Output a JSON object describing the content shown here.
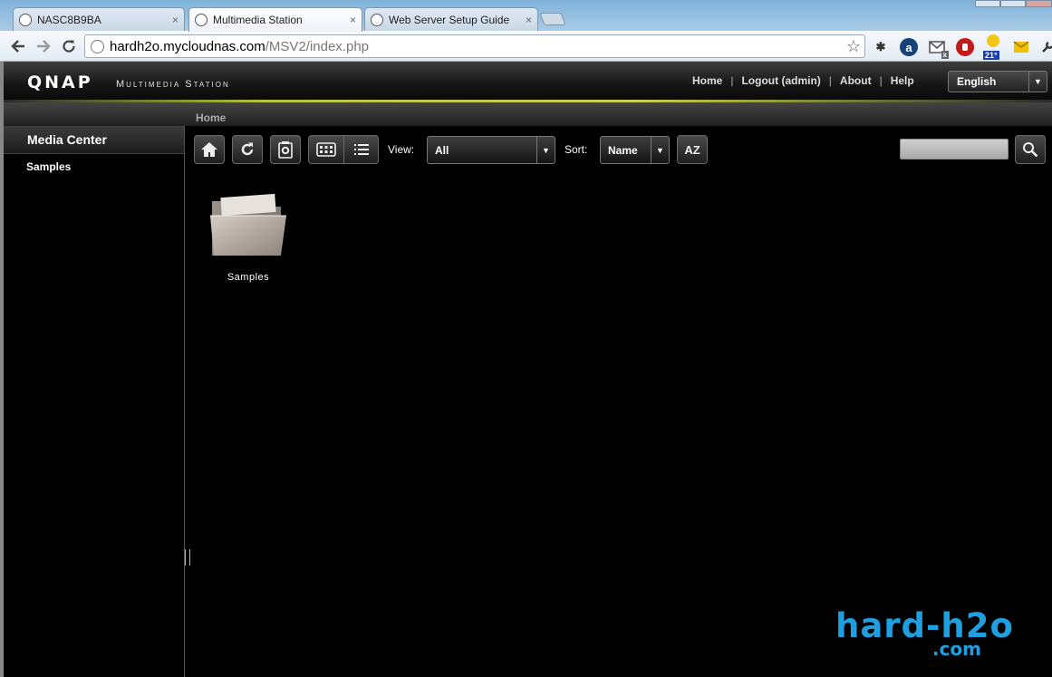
{
  "browser": {
    "tabs": [
      {
        "title": "NASC8B9BA",
        "active": false
      },
      {
        "title": "Multimedia Station",
        "active": true
      },
      {
        "title": "Web Server Setup Guide",
        "active": false
      }
    ],
    "close_glyph": "×",
    "address": {
      "host": "hardh2o.mycloudnas.com",
      "path": "/MSV2/index.php"
    },
    "extensions": {
      "mail_badge": "x",
      "weather_temp": "21°",
      "amazon_letter": "a"
    }
  },
  "app": {
    "logo_text": "QNAP",
    "title": "Multimedia Station",
    "nav": {
      "home": "Home",
      "logout": "Logout (admin)",
      "about": "About",
      "help": "Help",
      "separator": "|"
    },
    "language": {
      "selected": "English"
    }
  },
  "breadcrumb": {
    "current": "Home"
  },
  "sidebar": {
    "title": "Media Center",
    "items": [
      {
        "label": "Samples"
      }
    ]
  },
  "toolbar": {
    "view_label": "View:",
    "view_value": "All",
    "sort_label": "Sort:",
    "sort_value": "Name",
    "sort_az_text": "AZ"
  },
  "content": {
    "items": [
      {
        "label": "Samples",
        "type": "folder"
      }
    ]
  },
  "watermark": {
    "line1": "hard-h2o",
    "line2": ".com"
  },
  "colors": {
    "accent_stripe": "#c9d448",
    "watermark": "#1e9fe0",
    "background": "#000000"
  }
}
